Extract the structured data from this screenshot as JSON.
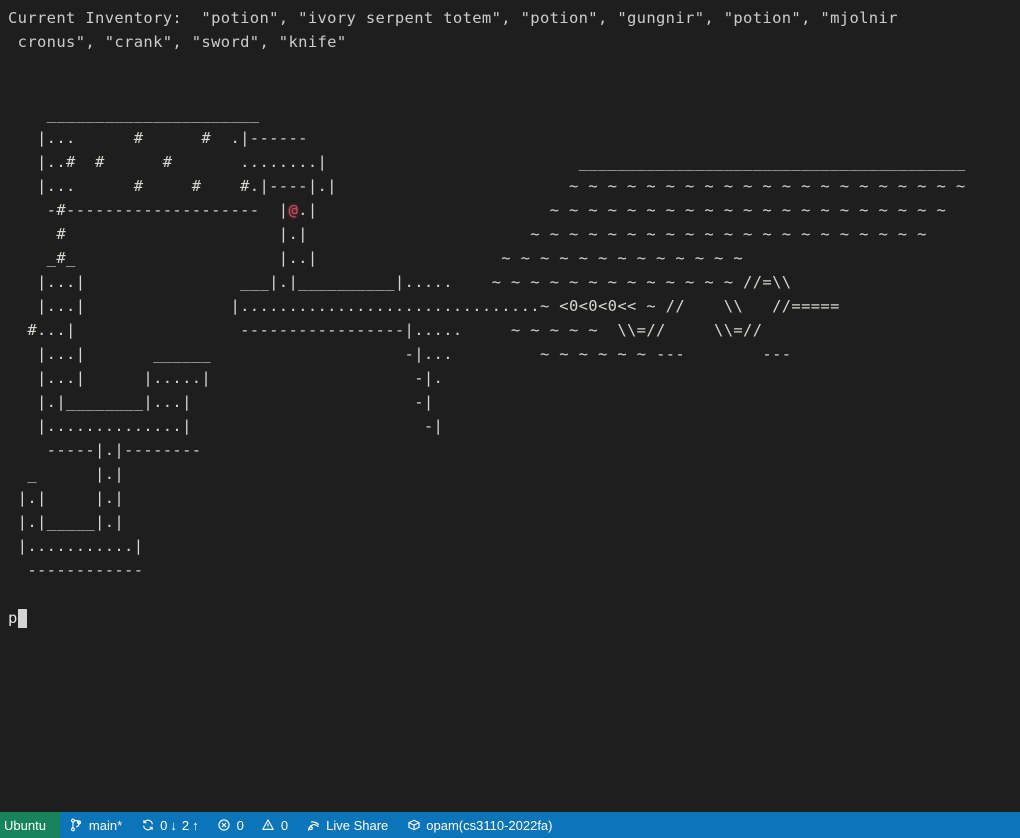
{
  "terminal": {
    "background": "#1e1e1e",
    "foreground": "#cccccc",
    "inventory_line_1": "Current Inventory:  \"potion\", \"ivory serpent totem\", \"potion\", \"gungnir\", \"potion\", \"mjolnir",
    "inventory_line_2": " cronus\", \"crank\", \"sword\", \"knife\"",
    "prompt_text": "p",
    "player_glyph": "@",
    "player_color": "#c94f62",
    "map_lines": [
      "    ______________________",
      "   |...      #      #  .|------",
      "   |..#  #      #       ........|",
      "   |...      #     #    #.|----|.|",
      "    -#--------------------  |@.|",
      "     #                      |.|",
      "    _#_                     |..|",
      "   |...|                ___|.|__________|.....",
      "   |...|               |...............................",
      "  #...|                 -----------------|.....",
      "   |...|       ______                    -|...",
      "   |...|      |.....|                     -|.",
      "   |.|________|...|                       -|",
      "   |..............|                        -|",
      "    -----|.|--------",
      "  _      |.|",
      " |.|     |.|",
      " |.|_____|.|",
      " |...........|",
      "  ------------"
    ],
    "water_lines": [
      "________________________________________",
      "~ ~ ~ ~ ~ ~ ~ ~ ~ ~ ~ ~ ~ ~ ~ ~ ~ ~ ~ ~ ~",
      "~ ~ ~ ~ ~ ~ ~ ~ ~ ~ ~ ~ ~ ~ ~ ~ ~ ~ ~ ~ ~",
      "~ ~ ~ ~ ~ ~ ~ ~ ~ ~ ~ ~ ~ ~ ~ ~ ~ ~ ~ ~ ~",
      "~ ~ ~ ~ ~ ~ ~ ~ ~ ~ ~ ~ ~",
      "~ ~ ~ ~ ~ ~ ~ ~ ~ ~ ~ ~ ~ //=\\\\",
      "~ <0<0<0<< ~ //    \\\\   //=====",
      "~ ~ ~ ~ ~  \\\\=//     \\\\=//",
      "~ ~ ~ ~ ~ ~ ---        ---"
    ],
    "ship_glyphs": [
      "//=\\\\",
      "<0<0<0<<",
      "\\\\=//",
      "---",
      "//====="
    ]
  },
  "status_bar": {
    "background": "#0c74b8",
    "remote_background": "#18845c",
    "remote_label": "Ubuntu",
    "branch_label": "main*",
    "sync_down": "0",
    "sync_up": "2",
    "sync_down_arrow": "↓",
    "sync_up_arrow": "↑",
    "errors_count": "0",
    "warnings_count": "0",
    "live_share_label": "Live Share",
    "opam_label": "opam(cs3110-2022fa)"
  }
}
